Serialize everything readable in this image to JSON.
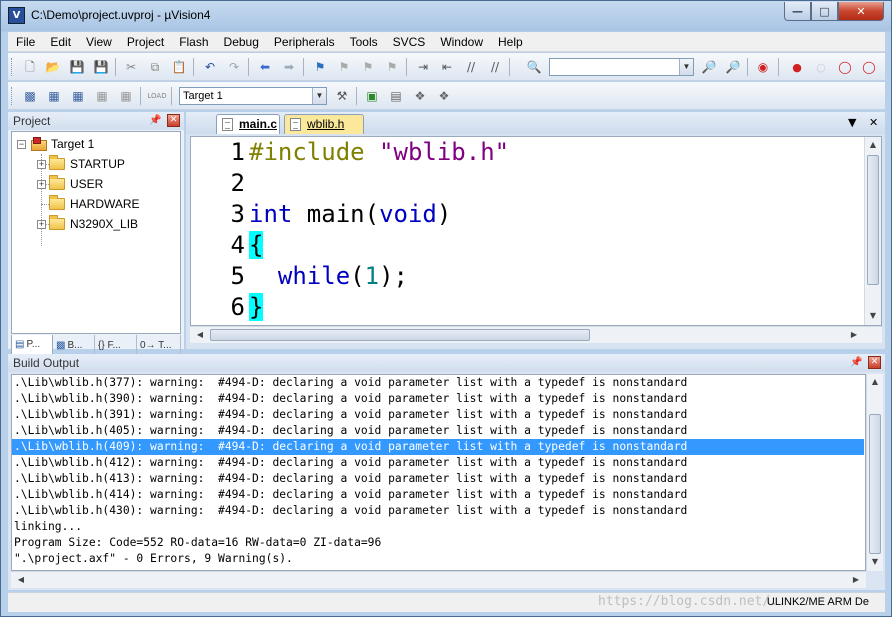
{
  "window": {
    "title": "C:\\Demo\\project.uvproj - µVision4",
    "icon_label": "V"
  },
  "menu": [
    "File",
    "Edit",
    "View",
    "Project",
    "Flash",
    "Debug",
    "Peripherals",
    "Tools",
    "SVCS",
    "Window",
    "Help"
  ],
  "toolbar2": {
    "target_combo": "Target 1"
  },
  "project_panel": {
    "title": "Project",
    "tree": {
      "root": "Target 1",
      "groups": [
        "STARTUP",
        "USER",
        "HARDWARE",
        "N3290X_LIB"
      ]
    },
    "tabs": [
      "P...",
      "B...",
      "{} F...",
      "0→ T..."
    ]
  },
  "editor": {
    "tabs": [
      "main.c",
      "wblib.h"
    ],
    "lines": [
      {
        "num": "1",
        "tokens": [
          {
            "t": "#include ",
            "c": "pp"
          },
          {
            "t": "\"wblib.h\"",
            "c": "str"
          }
        ]
      },
      {
        "num": "2",
        "tokens": []
      },
      {
        "num": "3",
        "tokens": [
          {
            "t": "int",
            "c": "kw"
          },
          {
            "t": " main(",
            "c": ""
          },
          {
            "t": "void",
            "c": "kw"
          },
          {
            "t": ")",
            "c": ""
          }
        ]
      },
      {
        "num": "4",
        "tokens": [
          {
            "t": "{",
            "c": "brace"
          }
        ]
      },
      {
        "num": "5",
        "tokens": [
          {
            "t": "  ",
            "c": ""
          },
          {
            "t": "while",
            "c": "kw"
          },
          {
            "t": "(",
            "c": ""
          },
          {
            "t": "1",
            "c": "num"
          },
          {
            "t": ");",
            "c": ""
          }
        ]
      },
      {
        "num": "6",
        "tokens": [
          {
            "t": "}",
            "c": "brace"
          }
        ]
      }
    ]
  },
  "build_output": {
    "title": "Build Output",
    "lines": [
      ".\\Lib\\wblib.h(377): warning:  #494-D: declaring a void parameter list with a typedef is nonstandard",
      ".\\Lib\\wblib.h(390): warning:  #494-D: declaring a void parameter list with a typedef is nonstandard",
      ".\\Lib\\wblib.h(391): warning:  #494-D: declaring a void parameter list with a typedef is nonstandard",
      ".\\Lib\\wblib.h(405): warning:  #494-D: declaring a void parameter list with a typedef is nonstandard",
      ".\\Lib\\wblib.h(409): warning:  #494-D: declaring a void parameter list with a typedef is nonstandard",
      ".\\Lib\\wblib.h(412): warning:  #494-D: declaring a void parameter list with a typedef is nonstandard",
      ".\\Lib\\wblib.h(413): warning:  #494-D: declaring a void parameter list with a typedef is nonstandard",
      ".\\Lib\\wblib.h(414): warning:  #494-D: declaring a void parameter list with a typedef is nonstandard",
      ".\\Lib\\wblib.h(430): warning:  #494-D: declaring a void parameter list with a typedef is nonstandard",
      "linking...",
      "Program Size: Code=552 RO-data=16 RW-data=0 ZI-data=96",
      "\".\\project.axf\" - 0 Errors, 9 Warning(s)."
    ],
    "selected_index": 4
  },
  "status": {
    "right_text": "ULINK2/ME ARM De",
    "watermark": "https://blog.csdn.net/..."
  },
  "colors": {
    "keyword": "#0000c0",
    "preprocessor": "#808000",
    "string": "#800080",
    "number": "#008080",
    "brace_highlight": "#00ffff",
    "selection": "#3399ff"
  }
}
